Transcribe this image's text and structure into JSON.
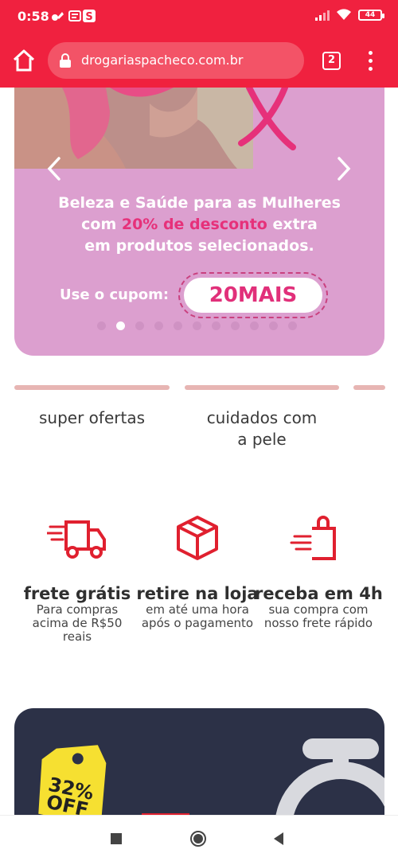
{
  "status_bar": {
    "time": "0:58",
    "battery": "44"
  },
  "browser": {
    "url": "drogariaspacheco.com.br",
    "tab_count": "2"
  },
  "banner": {
    "headline_line1": "Beleza e Saúde para as Mulheres",
    "headline_line2_pre": "com ",
    "headline_line2_highlight": "20% de desconto",
    "headline_line2_post": " extra",
    "headline_line3": "em produtos selecionados.",
    "coupon_label": "Use o cupom:",
    "coupon_code": "20MAIS",
    "dots_total": 11,
    "dots_active_index": 1,
    "highlight_color": "#e6317a",
    "background_color": "#dc9fcf"
  },
  "categories": [
    {
      "label": "super ofertas"
    },
    {
      "label_line1": "cuidados com",
      "label_line2": "a pele"
    }
  ],
  "features": [
    {
      "icon": "truck-icon",
      "title": "frete grátis",
      "desc_line1": "Para compras",
      "desc_line2": "acima de R$50",
      "desc_line3": "reais"
    },
    {
      "icon": "box-icon",
      "title": "retire na loja",
      "desc_line1": "em até uma hora",
      "desc_line2": "após o pagamento"
    },
    {
      "icon": "shopping-bag-icon",
      "title": "receba em 4h",
      "desc_line1": "sua compra com",
      "desc_line2": "nosso frete rápido"
    }
  ],
  "promo": {
    "tag_line1": "32%",
    "tag_line2": "OFF"
  },
  "colors": {
    "brand_red": "#f0213f",
    "icon_red": "#e0202f",
    "promo_bg": "#2c3147",
    "tag_yellow": "#f6e031"
  }
}
